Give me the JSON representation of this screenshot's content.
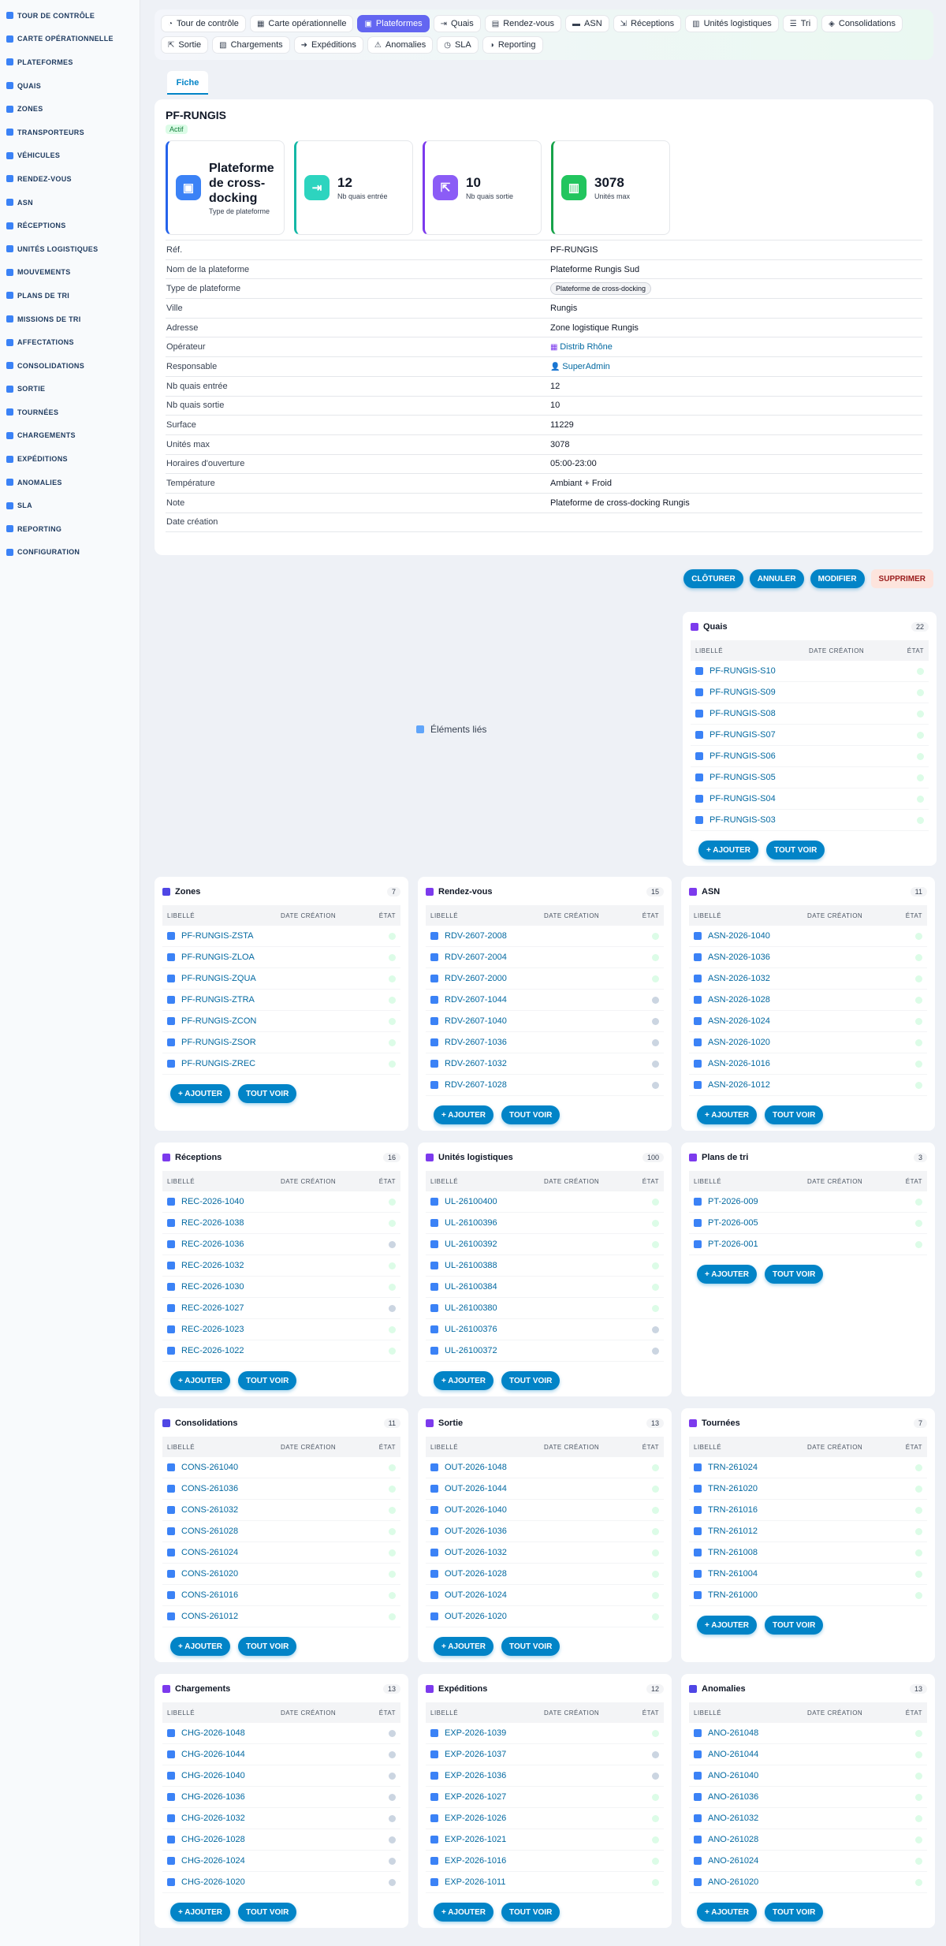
{
  "sidebar": {
    "items": [
      "Tour de contrôle",
      "Carte opérationnelle",
      "Plateformes",
      "Quais",
      "Zones",
      "Transporteurs",
      "Véhicules",
      "Rendez-vous",
      "ASN",
      "Réceptions",
      "Unités logistiques",
      "Mouvements",
      "Plans de tri",
      "Missions de tri",
      "Affectations",
      "Consolidations",
      "Sortie",
      "Tournées",
      "Chargements",
      "Expéditions",
      "Anomalies",
      "SLA",
      "Reporting",
      "Configuration"
    ]
  },
  "nav": {
    "row1": [
      {
        "label": "Tour de contrôle",
        "icon": "gauge-icon"
      },
      {
        "label": "Carte opérationnelle",
        "icon": "map-icon"
      },
      {
        "label": "Plateformes",
        "icon": "warehouse-icon",
        "active": true
      },
      {
        "label": "Quais",
        "icon": "dock-icon"
      },
      {
        "label": "Rendez-vous",
        "icon": "calendar-icon"
      },
      {
        "label": "ASN",
        "icon": "truck-icon"
      },
      {
        "label": "Réceptions",
        "icon": "receive-icon"
      },
      {
        "label": "Unités logistiques",
        "icon": "pallet-icon"
      },
      {
        "label": "Tri",
        "icon": "list-icon"
      },
      {
        "label": "Consolidations",
        "icon": "layers-icon"
      }
    ],
    "row2": [
      {
        "label": "Sortie",
        "icon": "exit-icon"
      },
      {
        "label": "Chargements",
        "icon": "loading-icon"
      },
      {
        "label": "Expéditions",
        "icon": "shipping-icon"
      },
      {
        "label": "Anomalies",
        "icon": "warning-icon"
      },
      {
        "label": "SLA",
        "icon": "timer-icon"
      },
      {
        "label": "Reporting",
        "icon": "chart-icon"
      }
    ]
  },
  "tab": "Fiche",
  "record": {
    "title": "PF-RUNGIS",
    "status": "Actif",
    "kpis": [
      {
        "value": "Plateforme de cross-docking",
        "label": "Type de plateforme",
        "color": "#2563eb",
        "iconbg": "#3b82f6"
      },
      {
        "value": "12",
        "label": "Nb quais entrée",
        "color": "#14b8a6",
        "iconbg": "#2dd4bf"
      },
      {
        "value": "10",
        "label": "Nb quais sortie",
        "color": "#7c3aed",
        "iconbg": "#8b5cf6"
      },
      {
        "value": "3078",
        "label": "Unités max",
        "color": "#16a34a",
        "iconbg": "#22c55e"
      }
    ],
    "fields": [
      {
        "label": "Réf.",
        "value": "PF-RUNGIS"
      },
      {
        "label": "Nom de la plateforme",
        "value": "Plateforme Rungis Sud"
      },
      {
        "label": "Type de plateforme",
        "value": "Plateforme de cross-docking",
        "kind": "tag"
      },
      {
        "label": "Ville",
        "value": "Rungis"
      },
      {
        "label": "Adresse",
        "value": "Zone logistique Rungis"
      },
      {
        "label": "Opérateur",
        "value": "Distrib Rhône",
        "kind": "link",
        "icon": "building-icon"
      },
      {
        "label": "Responsable",
        "value": "SuperAdmin",
        "kind": "link",
        "icon": "user-icon"
      },
      {
        "label": "Nb quais entrée",
        "value": "12"
      },
      {
        "label": "Nb quais sortie",
        "value": "10"
      },
      {
        "label": "Surface",
        "value": "11229"
      },
      {
        "label": "Unités max",
        "value": "3078"
      },
      {
        "label": "Horaires d'ouverture",
        "value": "05:00-23:00"
      },
      {
        "label": "Température",
        "value": "Ambiant + Froid"
      },
      {
        "label": "Note",
        "value": "Plateforme de cross-docking Rungis"
      },
      {
        "label": "Date création",
        "value": ""
      }
    ]
  },
  "actions": [
    "CLÔTURER",
    "ANNULER",
    "MODIFIER",
    "SUPPRIMER"
  ],
  "linked_title": "Éléments liés",
  "table_headers": [
    "LIBELLÉ",
    "DATE CRÉATION",
    "ÉTAT"
  ],
  "panel_buttons": [
    "+ AJOUTER",
    "TOUT VOIR"
  ],
  "colors": {
    "accent": "#0284c7",
    "active_nav": "#6366f1"
  },
  "panels": [
    {
      "title": "Quais",
      "count": "22",
      "icon": "dock-icon",
      "color": "#7c3aed",
      "rows": [
        "PF-RUNGIS-S10",
        "PF-RUNGIS-S09",
        "PF-RUNGIS-S08",
        "PF-RUNGIS-S07",
        "PF-RUNGIS-S06",
        "PF-RUNGIS-S05",
        "PF-RUNGIS-S04",
        "PF-RUNGIS-S03"
      ],
      "gray": []
    },
    {
      "title": "Zones",
      "count": "7",
      "icon": "grid-icon",
      "color": "#4f46e5",
      "rows": [
        "PF-RUNGIS-ZSTA",
        "PF-RUNGIS-ZLOA",
        "PF-RUNGIS-ZQUA",
        "PF-RUNGIS-ZTRA",
        "PF-RUNGIS-ZCON",
        "PF-RUNGIS-ZSOR",
        "PF-RUNGIS-ZREC"
      ],
      "gray": []
    },
    {
      "title": "Rendez-vous",
      "count": "15",
      "icon": "calendar-icon",
      "color": "#7c3aed",
      "rows": [
        "RDV-2607-2008",
        "RDV-2607-2004",
        "RDV-2607-2000",
        "RDV-2607-1044",
        "RDV-2607-1040",
        "RDV-2607-1036",
        "RDV-2607-1032",
        "RDV-2607-1028"
      ],
      "gray": [
        3,
        4,
        5,
        6,
        7
      ]
    },
    {
      "title": "ASN",
      "count": "11",
      "icon": "truck-icon",
      "color": "#7c3aed",
      "rows": [
        "ASN-2026-1040",
        "ASN-2026-1036",
        "ASN-2026-1032",
        "ASN-2026-1028",
        "ASN-2026-1024",
        "ASN-2026-1020",
        "ASN-2026-1016",
        "ASN-2026-1012"
      ],
      "gray": []
    },
    {
      "title": "Réceptions",
      "count": "16",
      "icon": "receive-icon",
      "color": "#7c3aed",
      "rows": [
        "REC-2026-1040",
        "REC-2026-1038",
        "REC-2026-1036",
        "REC-2026-1032",
        "REC-2026-1030",
        "REC-2026-1027",
        "REC-2026-1023",
        "REC-2026-1022"
      ],
      "gray": [
        2,
        5
      ]
    },
    {
      "title": "Unités logistiques",
      "count": "100",
      "icon": "pallet-icon",
      "color": "#7c3aed",
      "rows": [
        "UL-26100400",
        "UL-26100396",
        "UL-26100392",
        "UL-26100388",
        "UL-26100384",
        "UL-26100380",
        "UL-26100376",
        "UL-26100372"
      ],
      "gray": [
        6,
        7
      ]
    },
    {
      "title": "Plans de tri",
      "count": "3",
      "icon": "sort-icon",
      "color": "#7c3aed",
      "rows": [
        "PT-2026-009",
        "PT-2026-005",
        "PT-2026-001"
      ],
      "gray": []
    },
    {
      "title": "Consolidations",
      "count": "11",
      "icon": "layers-icon",
      "color": "#4f46e5",
      "rows": [
        "CONS-261040",
        "CONS-261036",
        "CONS-261032",
        "CONS-261028",
        "CONS-261024",
        "CONS-261020",
        "CONS-261016",
        "CONS-261012"
      ],
      "gray": []
    },
    {
      "title": "Sortie",
      "count": "13",
      "icon": "exit-icon",
      "color": "#7c3aed",
      "rows": [
        "OUT-2026-1048",
        "OUT-2026-1044",
        "OUT-2026-1040",
        "OUT-2026-1036",
        "OUT-2026-1032",
        "OUT-2026-1028",
        "OUT-2026-1024",
        "OUT-2026-1020"
      ],
      "gray": []
    },
    {
      "title": "Tournées",
      "count": "7",
      "icon": "route-icon",
      "color": "#7c3aed",
      "rows": [
        "TRN-261024",
        "TRN-261020",
        "TRN-261016",
        "TRN-261012",
        "TRN-261008",
        "TRN-261004",
        "TRN-261000"
      ],
      "gray": []
    },
    {
      "title": "Chargements",
      "count": "13",
      "icon": "loading-icon",
      "color": "#7c3aed",
      "rows": [
        "CHG-2026-1048",
        "CHG-2026-1044",
        "CHG-2026-1040",
        "CHG-2026-1036",
        "CHG-2026-1032",
        "CHG-2026-1028",
        "CHG-2026-1024",
        "CHG-2026-1020"
      ],
      "gray": [
        0,
        1,
        2,
        3,
        4,
        5,
        6,
        7
      ]
    },
    {
      "title": "Expéditions",
      "count": "12",
      "icon": "shipping-icon",
      "color": "#7c3aed",
      "rows": [
        "EXP-2026-1039",
        "EXP-2026-1037",
        "EXP-2026-1036",
        "EXP-2026-1027",
        "EXP-2026-1026",
        "EXP-2026-1021",
        "EXP-2026-1016",
        "EXP-2026-1011"
      ],
      "gray": [
        1,
        2
      ]
    },
    {
      "title": "Anomalies",
      "count": "13",
      "icon": "warning-icon",
      "color": "#4f46e5",
      "rows": [
        "ANO-261048",
        "ANO-261044",
        "ANO-261040",
        "ANO-261036",
        "ANO-261032",
        "ANO-261028",
        "ANO-261024",
        "ANO-261020"
      ],
      "gray": []
    }
  ]
}
